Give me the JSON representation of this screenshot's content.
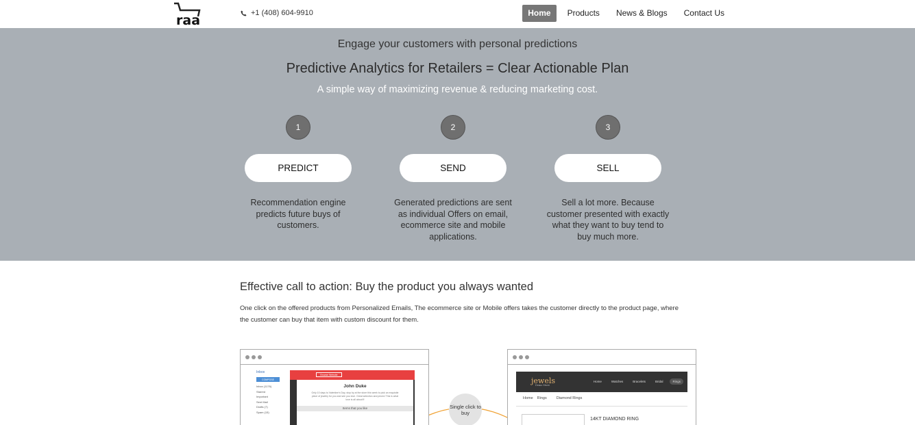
{
  "header": {
    "logo_text": "raa",
    "phone": "+1 (408) 604-9910",
    "nav": [
      {
        "label": "Home",
        "active": true
      },
      {
        "label": "Products",
        "active": false
      },
      {
        "label": "News & Blogs",
        "active": false
      },
      {
        "label": "Contact Us",
        "active": false
      }
    ]
  },
  "hero": {
    "tagline": "Engage your customers with personal predictions",
    "title": "Predictive Analytics for Retailers = Clear Actionable Plan",
    "subtitle": "A simple way of maximizing revenue & reducing marketing cost.",
    "steps": [
      {
        "number": "1",
        "label": "PREDICT",
        "description": "Recommendation engine predicts future buys of customers."
      },
      {
        "number": "2",
        "label": "SEND",
        "description": "Generated predictions are sent as individual Offers on email, ecommerce site and mobile applications."
      },
      {
        "number": "3",
        "label": "SELL",
        "description": "Sell a lot more. Because customer presented with exactly what they want to buy tend to buy much more."
      }
    ]
  },
  "content": {
    "heading": "Effective call to action: Buy the product you always wanted",
    "paragraph": "One click on the offered products from Personalized Emails, The ecommerce site or Mobile offers takes the customer directly to the product page, where the customer can buy that item with custom discount for them."
  },
  "email_mock": {
    "inbox": "Inbox",
    "compose": "COMPOSE",
    "folders": [
      "Inbox (1176)",
      "Starred",
      "Important",
      "Sent Mail",
      "Drafts (7)",
      "Spam (15)"
    ],
    "banner_button": "Browse Website",
    "recipient": "John Duke",
    "message": "Only 10 days to Valentine's Day, stop by at the store this week to pick an exquisite piece of jewelry for you and see you love. Great selection and prices! This is what love is all about!!!",
    "items_header": "Items that you like"
  },
  "shop_mock": {
    "logo": "jewels",
    "logo_sub": "Demo Store",
    "nav": [
      "Home",
      "Watches",
      "Bracelets",
      "Bridal",
      "Rings"
    ],
    "active_nav": "Rings",
    "breadcrumb": [
      "Home",
      "Rings"
    ],
    "section": "Diamond Rings",
    "product_title": "14KT  DIAMOND RING"
  },
  "connector": {
    "label": "Single click to buy"
  },
  "colors": {
    "hero_bg": "#a9afb5",
    "active_nav_bg": "#777777",
    "step_circle": "#6f6f6f",
    "connector_arc": "#f0a030",
    "email_banner": "#e84040"
  }
}
